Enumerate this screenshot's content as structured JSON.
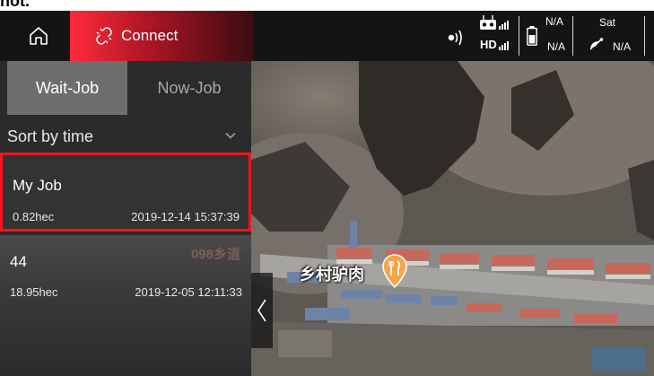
{
  "page_fragment": "not.",
  "header": {
    "connect_label": "Connect",
    "hd_label": "HD",
    "battery_value_top": "N/A",
    "battery_value_bottom": "N/A",
    "sat_label": "Sat",
    "sat_value": "N/A"
  },
  "tabs": [
    {
      "label": "Wait-Job",
      "active": true
    },
    {
      "label": "Now-Job",
      "active": false
    }
  ],
  "sort": {
    "label": "Sort by time"
  },
  "jobs": [
    {
      "name": "My Job",
      "area": "0.82hec",
      "datetime": "2019-12-14 15:37:39",
      "selected": true
    },
    {
      "name": "44",
      "area": "18.95hec",
      "datetime": "2019-12-05 12:11:33",
      "selected": false
    }
  ],
  "map": {
    "poi_label": "乡村驴肉",
    "background_text": "098乡道"
  },
  "colors": {
    "accent": "#e8202f",
    "selection_border": "#ff1020",
    "poi": "#f5a64a"
  },
  "icons": {
    "home": "home-icon",
    "connect": "link-broken-icon",
    "remote": "signal-broadcast-icon",
    "controller": "remote-controller-icon",
    "battery": "battery-icon",
    "satellite": "satellite-dish-icon",
    "sort": "chevron-down-icon",
    "collapse": "chevron-left-icon",
    "poi": "restaurant-pin-icon"
  }
}
